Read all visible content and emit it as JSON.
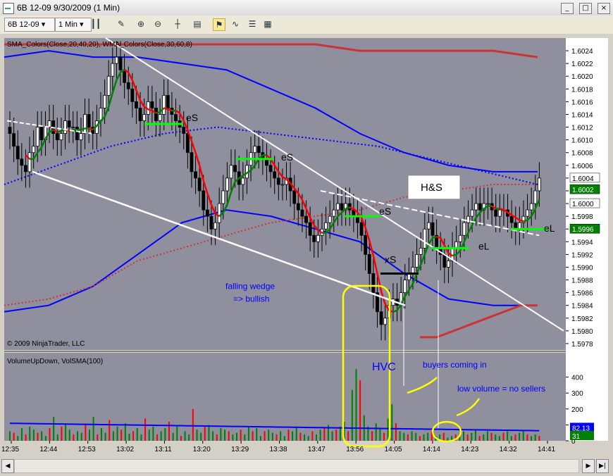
{
  "window": {
    "title": "6B 12-09  9/30/2009 (1 Min)",
    "minimize": "_",
    "maximize": "□",
    "close": "×"
  },
  "toolbar": {
    "instrument": "6B 12-09",
    "interval": "1 Min",
    "icons": [
      "candlestick-icon",
      "pencil-icon",
      "zoom-in-icon",
      "zoom-out-icon",
      "crosshair-icon",
      "properties-icon",
      "strategy-icon",
      "indicator-icon",
      "data-box-icon"
    ]
  },
  "colors": {
    "panel_bg": "#8f8f9e",
    "up_bar": "#ffffff",
    "down_bar": "#000000",
    "sma_up": "#008000",
    "sma_down": "#ff0000",
    "bollinger_blue": "#0000ff",
    "vol_up": "#008000",
    "vol_down": "#ff0000",
    "highlight": "#ffff00",
    "annotation": "#0000ff",
    "marker_green": "#00ff00"
  },
  "chart_data": {
    "type": "candlestick",
    "price_panel": {
      "indicator_label": "SMA_Colors(Close,20,40,20), WMA_Colors(Close,30,60,8)",
      "copyright": "© 2009 NinjaTrader, LLC",
      "ylim": [
        1.5977,
        1.6026
      ],
      "y_ticks": [
        "1.6024",
        "1.6022",
        "1.6020",
        "1.6018",
        "1.6016",
        "1.6014",
        "1.6012",
        "1.6010",
        "1.6008",
        "1.6006",
        "1.6004",
        "1.6002",
        "1.6000",
        "1.5998",
        "1.5996",
        "1.5994",
        "1.5992",
        "1.5990",
        "1.5988",
        "1.5986",
        "1.5984",
        "1.5982",
        "1.5980",
        "1.5978"
      ],
      "tick_values": [
        1.6024,
        1.6022,
        1.602,
        1.6018,
        1.6016,
        1.6014,
        1.6012,
        1.601,
        1.6008,
        1.6006,
        1.6004,
        1.6002,
        1.6,
        1.5998,
        1.5996,
        1.5994,
        1.5992,
        1.599,
        1.5988,
        1.5986,
        1.5984,
        1.5982,
        1.598,
        1.5978
      ],
      "price_labels": [
        {
          "text": "1.6004",
          "value": 1.6004,
          "bg": "#ffffff",
          "fg": "#000000"
        },
        {
          "text": "1.6002",
          "value": 1.60022,
          "bg": "#008000",
          "fg": "#ffffff"
        },
        {
          "text": "1.6000",
          "value": 1.6,
          "bg": "#ffffff",
          "fg": "#000000"
        },
        {
          "text": "1.5996",
          "value": 1.5996,
          "bg": "#008000",
          "fg": "#ffffff"
        }
      ],
      "closes": [
        1.6011,
        1.6009,
        1.6007,
        1.6006,
        1.6005,
        1.6008,
        1.6009,
        1.6012,
        1.601,
        1.6012,
        1.6013,
        1.6011,
        1.601,
        1.6011,
        1.6013,
        1.6012,
        1.6012,
        1.601,
        1.6011,
        1.6014,
        1.6012,
        1.6011,
        1.6013,
        1.6015,
        1.6017,
        1.602,
        1.6022,
        1.6023,
        1.6021,
        1.6019,
        1.6018,
        1.6016,
        1.6015,
        1.6013,
        1.6014,
        1.6016,
        1.6015,
        1.6013,
        1.6014,
        1.6017,
        1.6015,
        1.6014,
        1.6013,
        1.6012,
        1.6011,
        1.6008,
        1.6005,
        1.6004,
        1.6002,
        1.5999,
        1.5998,
        1.5996,
        1.5997,
        1.6,
        1.6002,
        1.6004,
        1.6006,
        1.6005,
        1.6003,
        1.6004,
        1.6006,
        1.6008,
        1.6009,
        1.6008,
        1.6007,
        1.6006,
        1.6005,
        1.6004,
        1.6003,
        1.6003,
        1.6004,
        1.6002,
        1.6,
        1.5999,
        1.5998,
        1.5997,
        1.5995,
        1.5994,
        1.5995,
        1.5996,
        1.5997,
        1.5998,
        1.5999,
        1.6,
        1.5999,
        1.6,
        1.5999,
        1.5998,
        1.5997,
        1.5995,
        1.5992,
        1.5989,
        1.5986,
        1.5983,
        1.5981,
        1.5982,
        1.5984,
        1.5985,
        1.5984,
        1.5986,
        1.5988,
        1.5989,
        1.599,
        1.5992,
        1.5993,
        1.5996,
        1.5997,
        1.5995,
        1.5993,
        1.5992,
        1.599,
        1.5991,
        1.5993,
        1.5994,
        1.5995,
        1.5997,
        1.5998,
        1.5999,
        1.6,
        1.5999,
        1.6,
        1.6,
        1.5999,
        1.5998,
        1.5999,
        1.5999,
        1.5998,
        1.5997,
        1.5996,
        1.5997,
        1.5998,
        1.5999,
        1.6,
        1.6002,
        1.6004
      ],
      "series": [
        {
          "role": "upper_bb_outer",
          "color": "#0000ff",
          "values": [
            1.6023,
            1.6024,
            1.6023,
            1.6023,
            1.6022,
            1.6021,
            1.6018,
            1.6015,
            1.6011,
            1.6008,
            1.6006,
            1.6005,
            1.6005
          ]
        },
        {
          "role": "lower_bb_outer",
          "color": "#0000ff",
          "values": [
            1.5983,
            1.5984,
            1.5987,
            1.5992,
            1.5997,
            1.5999,
            1.5998,
            1.5996,
            1.5994,
            1.5989,
            1.5985,
            1.5984,
            1.5984
          ]
        },
        {
          "role": "sma40",
          "color": "#cc3333",
          "values": [
            1.5984,
            1.5985,
            1.5987,
            1.5991,
            1.5993,
            1.5995,
            1.5997,
            1.5998,
            1.5999,
            1.6001,
            1.6002,
            1.6003,
            1.6003
          ]
        },
        {
          "role": "upper_red_band",
          "color": "#cc3333",
          "values": [
            1.6025,
            1.6025,
            1.6025,
            1.6025,
            1.6025,
            1.6025,
            1.6025,
            1.6025,
            1.6024,
            1.6024,
            1.6024,
            1.6024,
            1.6023
          ]
        },
        {
          "role": "lower_red_band",
          "color": "#cc3333",
          "values": [
            1.5979,
            1.5979,
            1.598,
            1.5981,
            1.5982,
            1.5983,
            1.5984,
            1.5984
          ]
        },
        {
          "role": "sma_blue_dotted",
          "color": "#0000ff",
          "values": [
            1.6003,
            1.6006,
            1.6009,
            1.6011,
            1.6012,
            1.6011,
            1.601,
            1.6009,
            1.6007,
            1.6005,
            1.6003
          ]
        }
      ],
      "annotations": [
        {
          "text": "eS",
          "price": 1.60125
        },
        {
          "text": "eS",
          "price": 1.6007
        },
        {
          "text": "eS",
          "price": 1.5998
        },
        {
          "text": "xS",
          "price": 1.599
        },
        {
          "text": "eL",
          "price": 1.5993
        },
        {
          "text": "eL",
          "price": 1.5996
        },
        {
          "text": "H&S",
          "price": 1.60025
        },
        {
          "text": "falling wedge",
          "price": 1.5987
        },
        {
          "text": "=> bullish",
          "price": 1.5985
        }
      ]
    },
    "volume_panel": {
      "indicator_label": "VolumeUpDown, VolSMA(100)",
      "ylim": [
        0,
        500
      ],
      "y_ticks": [
        "400",
        "300",
        "200",
        "100",
        "0"
      ],
      "tick_values": [
        400,
        300,
        200,
        100,
        0
      ],
      "labels": [
        {
          "text": "82.13",
          "value": 82.13,
          "bg": "#0000ff",
          "fg": "#ffffff"
        },
        {
          "text": "31",
          "value": 31,
          "bg": "#008000",
          "fg": "#ffffff"
        }
      ],
      "annotations": [
        "HVC",
        "buyers coming in",
        "low volume = no sellers"
      ],
      "volumes": [
        60,
        50,
        30,
        80,
        40,
        90,
        70,
        50,
        60,
        30,
        80,
        150,
        40,
        90,
        110,
        70,
        40,
        60,
        50,
        100,
        70,
        150,
        40,
        80,
        50,
        130,
        60,
        90,
        70,
        110,
        45,
        60,
        80,
        40,
        140,
        70,
        90,
        40,
        60,
        80,
        120,
        50,
        90,
        30,
        60,
        40,
        200,
        70,
        50,
        90,
        100,
        60,
        40,
        80,
        70,
        60,
        40,
        50,
        70,
        40,
        90,
        60,
        80,
        30,
        60,
        70,
        50,
        40,
        60,
        30,
        70,
        60,
        90,
        50,
        40,
        30,
        60,
        40,
        70,
        80,
        100,
        60,
        70,
        90,
        120,
        60,
        320,
        450,
        380,
        160,
        90,
        60,
        110,
        80,
        50,
        140,
        230,
        110,
        60,
        50,
        40,
        60,
        50,
        30,
        40,
        50,
        60,
        30,
        40,
        50,
        20,
        30,
        40,
        30,
        60,
        40,
        50,
        70,
        30,
        40,
        60,
        50,
        40,
        30,
        50,
        60,
        30,
        40,
        50,
        60,
        40,
        30,
        40,
        31
      ]
    },
    "x_ticks": [
      "12:35",
      "12:44",
      "12:53",
      "13:02",
      "13:11",
      "13:20",
      "13:29",
      "13:38",
      "13:47",
      "13:56",
      "14:05",
      "14:14",
      "14:23",
      "14:32",
      "14:41"
    ]
  }
}
